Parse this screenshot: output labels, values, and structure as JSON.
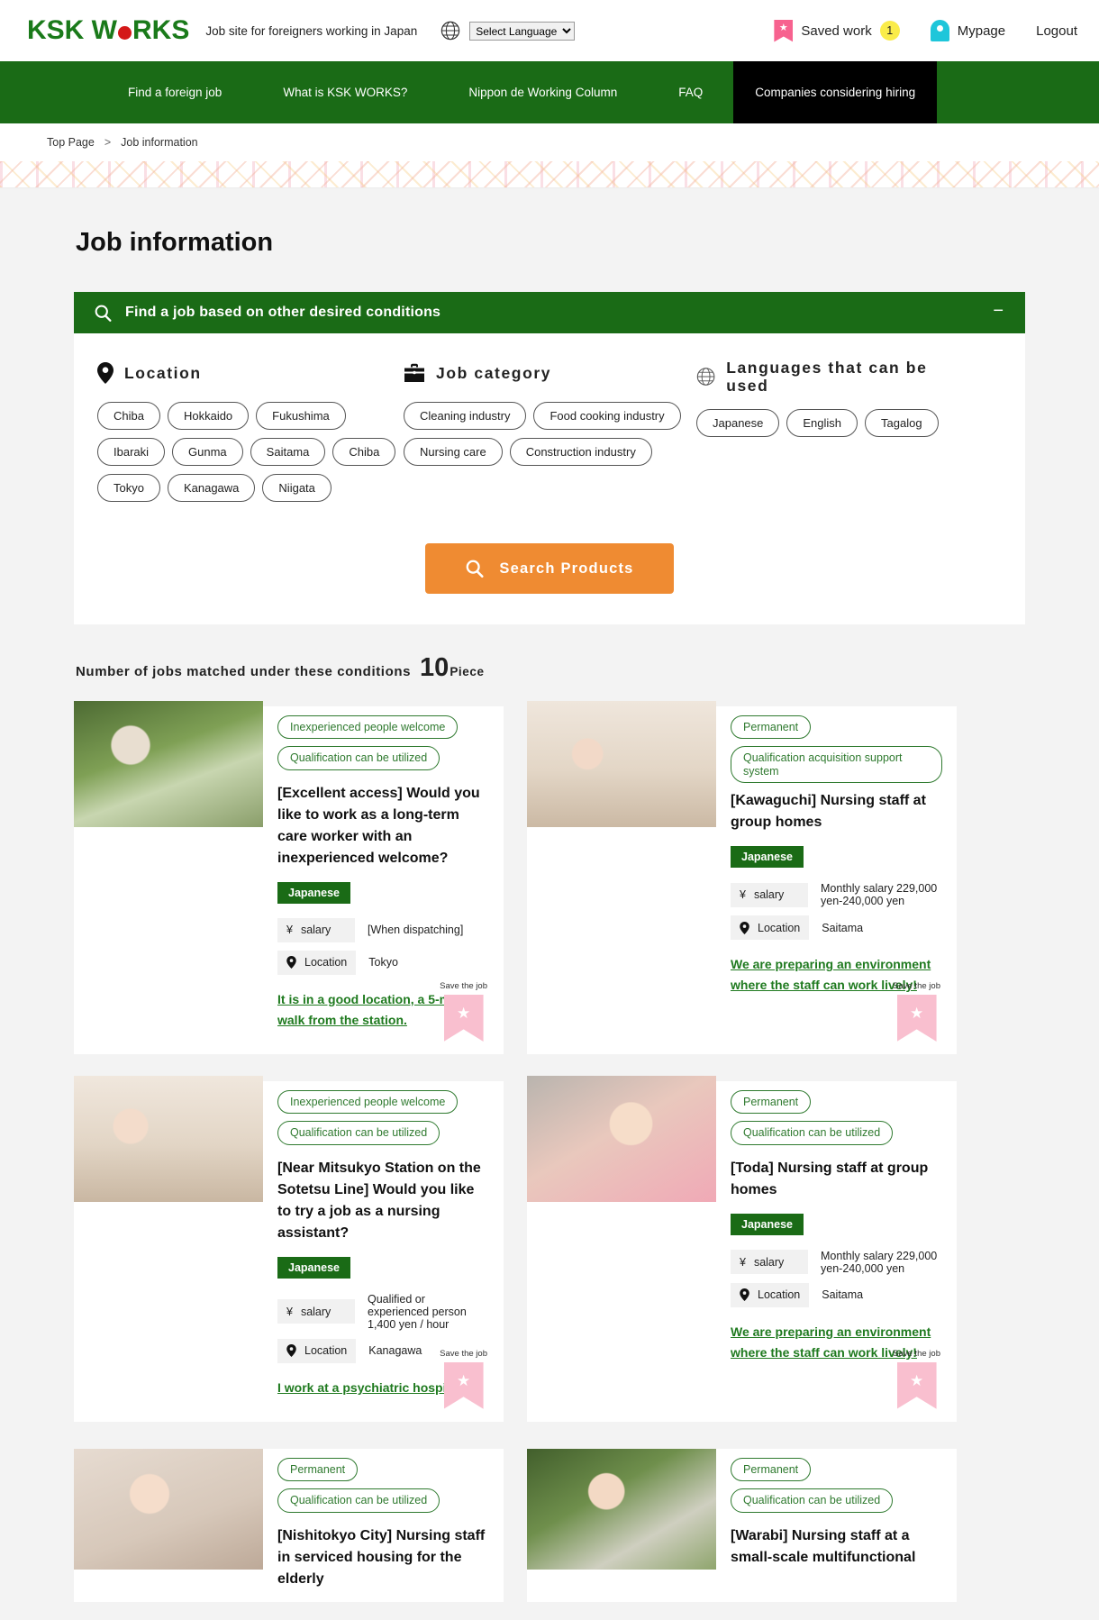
{
  "header": {
    "logo_text_1": "KSK W",
    "logo_text_2": "RKS",
    "tagline": "Job site for foreigners working in Japan",
    "language_select_value": "Select Language",
    "saved_work_label": "Saved work",
    "saved_work_count": "1",
    "mypage_label": "Mypage",
    "logout_label": "Logout"
  },
  "nav": {
    "items": [
      {
        "label": "Find a foreign job",
        "highlight": false
      },
      {
        "label": "What is KSK WORKS?",
        "highlight": false
      },
      {
        "label": "Nippon de Working Column",
        "highlight": false
      },
      {
        "label": "FAQ",
        "highlight": false
      },
      {
        "label": "Companies considering hiring",
        "highlight": true
      }
    ]
  },
  "breadcrumb": {
    "home": "Top Page",
    "separator": ">",
    "current": "Job information"
  },
  "page": {
    "title": "Job information"
  },
  "filter_panel": {
    "heading": "Find a job based on other desired conditions",
    "collapse_symbol": "−",
    "location": {
      "label": "Location",
      "chips": [
        "Chiba",
        "Hokkaido",
        "Fukushima",
        "Ibaraki",
        "Gunma",
        "Saitama",
        "Chiba",
        "Tokyo",
        "Kanagawa",
        "Niigata"
      ]
    },
    "job_category": {
      "label": "Job category",
      "chips": [
        "Cleaning industry",
        "Food cooking industry",
        "Nursing care",
        "Construction industry"
      ]
    },
    "languages": {
      "label": "Languages that can be used",
      "chips": [
        "Japanese",
        "English",
        "Tagalog"
      ]
    },
    "search_button": "Search Products"
  },
  "results": {
    "count_prefix": "Number of jobs matched under these conditions",
    "count": "10",
    "count_unit": "Piece",
    "save_label": "Save the job",
    "salary_key": "salary",
    "location_key": "Location",
    "jobs": [
      {
        "tags": [
          "Inexperienced people welcome",
          "Qualification can be utilized"
        ],
        "title": "[Excellent access] Would you like to work as a long-term care worker with an inexperienced welcome?",
        "language": "Japanese",
        "salary": "[When dispatching]",
        "location": "Tokyo",
        "link": "It is in a good location, a 5-minute walk from the station."
      },
      {
        "tags": [
          "Permanent",
          "Qualification acquisition support system"
        ],
        "title": "[Kawaguchi] Nursing staff at group homes",
        "language": "Japanese",
        "salary": "Monthly salary 229,000 yen-240,000 yen",
        "location": "Saitama",
        "link": "We are preparing an environment where the staff can work lively!"
      },
      {
        "tags": [
          "Inexperienced people welcome",
          "Qualification can be utilized"
        ],
        "title": "[Near Mitsukyo Station on the Sotetsu Line] Would you like to try a job as a nursing assistant?",
        "language": "Japanese",
        "salary": "Qualified or experienced person 1,400 yen / hour",
        "location": "Kanagawa",
        "link": "I work at a psychiatric hospital."
      },
      {
        "tags": [
          "Permanent",
          "Qualification can be utilized"
        ],
        "title": "[Toda] Nursing staff at group homes",
        "language": "Japanese",
        "salary": "Monthly salary 229,000 yen-240,000 yen",
        "location": "Saitama",
        "link": "We are preparing an environment where the staff can work lively!"
      },
      {
        "tags": [
          "Permanent",
          "Qualification can be utilized"
        ],
        "title": "[Nishitokyo City] Nursing staff in serviced housing for the elderly",
        "language": "",
        "salary": "",
        "location": "",
        "link": ""
      },
      {
        "tags": [
          "Permanent",
          "Qualification can be utilized"
        ],
        "title": "[Warabi] Nursing staff at a small-scale multifunctional",
        "language": "",
        "salary": "",
        "location": "",
        "link": ""
      }
    ]
  },
  "colors": {
    "brand_green": "#1a6b16",
    "logo_green": "#1a7a1a",
    "logo_dot_red": "#d41818",
    "accent_orange": "#ef8b32",
    "pink_bookmark": "#f7628f",
    "badge_yellow": "#faec4a",
    "cyan": "#1ec6da"
  }
}
